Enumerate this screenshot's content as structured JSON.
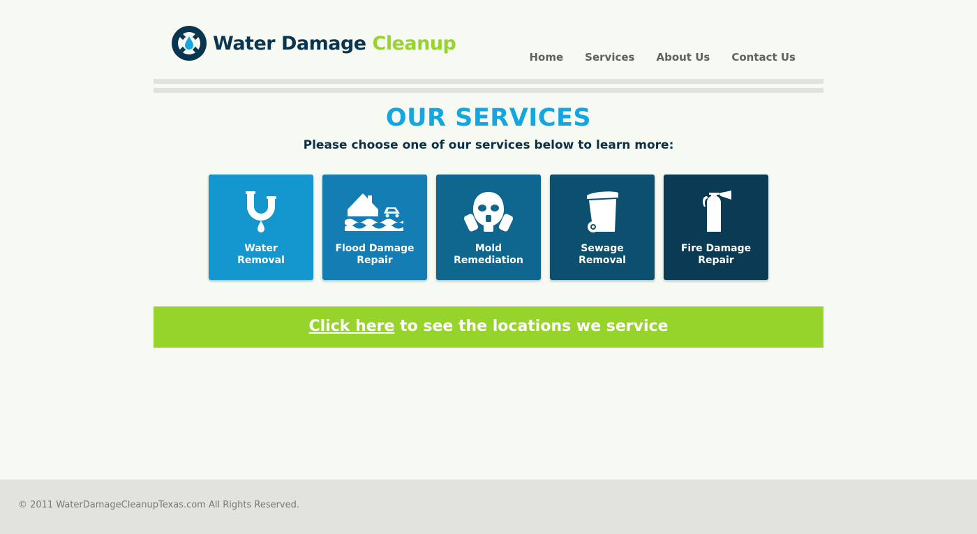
{
  "brand": {
    "name_part1": "Water Damage",
    "name_part2": "Cleanup",
    "logo_icon": "lifebuoy-water-drop-icon",
    "colors": {
      "dark": "#0a3550",
      "accent": "#96d42b",
      "blue": "#14a6e0"
    }
  },
  "nav": {
    "items": [
      {
        "label": "Home"
      },
      {
        "label": "Services"
      },
      {
        "label": "About Us"
      },
      {
        "label": "Contact Us"
      }
    ]
  },
  "main": {
    "title": "OUR SERVICES",
    "subtitle": "Please choose one of our services below to learn more:",
    "services": [
      {
        "line1": "Water",
        "line2": "Removal",
        "icon": "pipe-drip-icon",
        "color": "#1496cf"
      },
      {
        "line1": "Flood Damage",
        "line2": "Repair",
        "icon": "flooded-house-icon",
        "color": "#137db4"
      },
      {
        "line1": "Mold",
        "line2": "Remediation",
        "icon": "gas-mask-icon",
        "color": "#0f6790"
      },
      {
        "line1": "Sewage",
        "line2": "Removal",
        "icon": "trash-bin-icon",
        "color": "#0c4f6f"
      },
      {
        "line1": "Fire Damage",
        "line2": "Repair",
        "icon": "fire-extinguisher-icon",
        "color": "#0a3a54"
      }
    ],
    "cta": {
      "link_text": "Click here",
      "rest_text": " to see the locations we service",
      "color": "#96d42b"
    }
  },
  "footer": {
    "copyright": "© 2011 WaterDamageCleanupTexas.com All Rights Reserved."
  }
}
